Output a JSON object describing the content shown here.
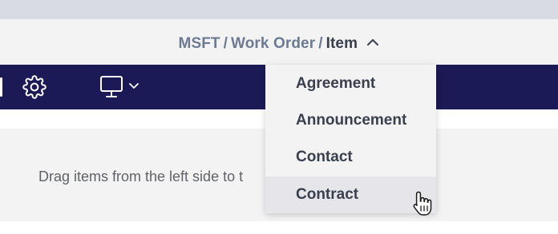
{
  "breadcrumb": {
    "items": [
      "MSFT",
      "Work Order"
    ],
    "separator": "/",
    "current": "Item"
  },
  "icons": {
    "breadcrumb_toggle": "chevron-up-icon",
    "settings": "gear-icon",
    "device_preview": "monitor-icon",
    "device_dropdown": "chevron-down-icon",
    "pointer": "hand-pointer-icon"
  },
  "canvas": {
    "hint": "Drag items from the left side to t"
  },
  "dropdown": {
    "items": [
      {
        "label": "Agreement"
      },
      {
        "label": "Announcement"
      },
      {
        "label": "Contact"
      },
      {
        "label": "Contract"
      }
    ],
    "hovered": "Contract"
  },
  "colors": {
    "toolbar_bg": "#1b1a57",
    "breadcrumb_bar_bg": "#f3f3f4",
    "top_strip_bg": "#d8dbe3",
    "breadcrumb_link": "#6c7a92",
    "breadcrumb_current": "#3a3f4d",
    "menu_hover_bg": "#e5e5ea"
  }
}
